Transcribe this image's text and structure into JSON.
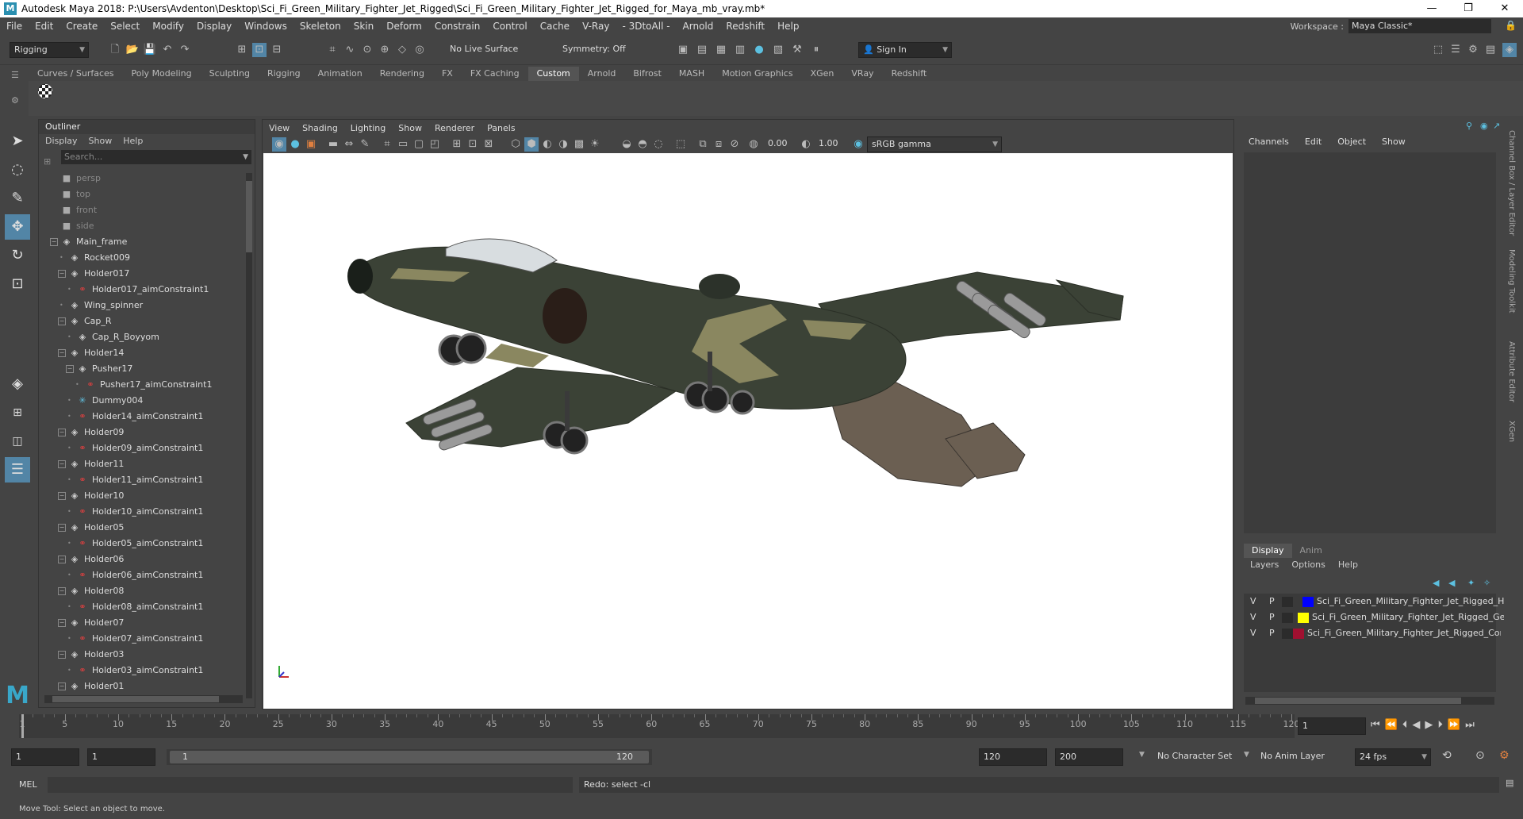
{
  "window": {
    "title": "Autodesk Maya 2018: P:\\Users\\Avdenton\\Desktop\\Sci_Fi_Green_Military_Fighter_Jet_Rigged\\Sci_Fi_Green_Military_Fighter_Jet_Rigged_for_Maya_mb_vray.mb*",
    "minimize": "—",
    "maximize": "❐",
    "close": "✕"
  },
  "menubar": {
    "items": [
      "File",
      "Edit",
      "Create",
      "Select",
      "Modify",
      "Display",
      "Windows",
      "Skeleton",
      "Skin",
      "Deform",
      "Constrain",
      "Control",
      "Cache",
      "V-Ray",
      "- 3DtoAll -",
      "Arnold",
      "Redshift",
      "Help"
    ],
    "workspace_label": "Workspace :",
    "workspace_value": "Maya Classic*"
  },
  "statusline": {
    "mode": "Rigging",
    "live_surface": "No Live Surface",
    "symmetry": "Symmetry: Off",
    "sign_in": "Sign In"
  },
  "shelf": {
    "tabs": [
      "Curves / Surfaces",
      "Poly Modeling",
      "Sculpting",
      "Rigging",
      "Animation",
      "Rendering",
      "FX",
      "FX Caching",
      "Custom",
      "Arnold",
      "Bifrost",
      "MASH",
      "Motion Graphics",
      "XGen",
      "VRay",
      "Redshift"
    ],
    "active_tab": "Custom"
  },
  "outliner": {
    "title": "Outliner",
    "menu": [
      "Display",
      "Show",
      "Help"
    ],
    "search_placeholder": "Search...",
    "rows": [
      {
        "label": "persp",
        "type": "cam",
        "depth": 0,
        "dim": true
      },
      {
        "label": "top",
        "type": "cam",
        "depth": 0,
        "dim": true
      },
      {
        "label": "front",
        "type": "cam",
        "depth": 0,
        "dim": true
      },
      {
        "label": "side",
        "type": "cam",
        "depth": 0,
        "dim": true
      },
      {
        "label": "Main_frame",
        "type": "tr",
        "depth": 0,
        "exp": "-"
      },
      {
        "label": "Rocket009",
        "type": "tr",
        "depth": 1
      },
      {
        "label": "Holder017",
        "type": "tr",
        "depth": 1,
        "exp": "-"
      },
      {
        "label": "Holder017_aimConstraint1",
        "type": "con",
        "depth": 2
      },
      {
        "label": "Wing_spinner",
        "type": "tr",
        "depth": 1
      },
      {
        "label": "Cap_R",
        "type": "tr",
        "depth": 1,
        "exp": "-"
      },
      {
        "label": "Cap_R_Boyyom",
        "type": "tr",
        "depth": 2
      },
      {
        "label": "Holder14",
        "type": "tr",
        "depth": 1,
        "exp": "-"
      },
      {
        "label": "Pusher17",
        "type": "tr",
        "depth": 2,
        "exp": "-"
      },
      {
        "label": "Pusher17_aimConstraint1",
        "type": "con",
        "depth": 3
      },
      {
        "label": "Dummy004",
        "type": "dum",
        "depth": 2
      },
      {
        "label": "Holder14_aimConstraint1",
        "type": "con",
        "depth": 2
      },
      {
        "label": "Holder09",
        "type": "tr",
        "depth": 1,
        "exp": "-"
      },
      {
        "label": "Holder09_aimConstraint1",
        "type": "con",
        "depth": 2
      },
      {
        "label": "Holder11",
        "type": "tr",
        "depth": 1,
        "exp": "-"
      },
      {
        "label": "Holder11_aimConstraint1",
        "type": "con",
        "depth": 2
      },
      {
        "label": "Holder10",
        "type": "tr",
        "depth": 1,
        "exp": "-"
      },
      {
        "label": "Holder10_aimConstraint1",
        "type": "con",
        "depth": 2
      },
      {
        "label": "Holder05",
        "type": "tr",
        "depth": 1,
        "exp": "-"
      },
      {
        "label": "Holder05_aimConstraint1",
        "type": "con",
        "depth": 2
      },
      {
        "label": "Holder06",
        "type": "tr",
        "depth": 1,
        "exp": "-"
      },
      {
        "label": "Holder06_aimConstraint1",
        "type": "con",
        "depth": 2
      },
      {
        "label": "Holder08",
        "type": "tr",
        "depth": 1,
        "exp": "-"
      },
      {
        "label": "Holder08_aimConstraint1",
        "type": "con",
        "depth": 2
      },
      {
        "label": "Holder07",
        "type": "tr",
        "depth": 1,
        "exp": "-"
      },
      {
        "label": "Holder07_aimConstraint1",
        "type": "con",
        "depth": 2
      },
      {
        "label": "Holder03",
        "type": "tr",
        "depth": 1,
        "exp": "-"
      },
      {
        "label": "Holder03_aimConstraint1",
        "type": "con",
        "depth": 2
      },
      {
        "label": "Holder01",
        "type": "tr",
        "depth": 1,
        "exp": "-"
      }
    ]
  },
  "viewport": {
    "menu": [
      "View",
      "Shading",
      "Lighting",
      "Show",
      "Renderer",
      "Panels"
    ],
    "exposure": "0.00",
    "gamma": "1.00",
    "color_space": "sRGB gamma",
    "colors": {
      "body": "#3b4236",
      "camo": "#8a8760",
      "metal": "#7a6a5a"
    }
  },
  "channelbox": {
    "menu": [
      "Channels",
      "Edit",
      "Object",
      "Show"
    ]
  },
  "layer_editor": {
    "tabs": [
      "Display",
      "Anim"
    ],
    "active_tab": "Display",
    "menu": [
      "Layers",
      "Options",
      "Help"
    ],
    "layers": [
      {
        "v": "V",
        "p": "P",
        "color": "#0000ff",
        "name": "Sci_Fi_Green_Military_Fighter_Jet_Rigged_Helpers"
      },
      {
        "v": "V",
        "p": "P",
        "color": "#ffff00",
        "name": "Sci_Fi_Green_Military_Fighter_Jet_Rigged_Geometry"
      },
      {
        "v": "V",
        "p": "P",
        "color": "#a01030",
        "name": "Sci_Fi_Green_Military_Fighter_Jet_Rigged_Controllers"
      }
    ]
  },
  "side_tabs": [
    "Channel Box / Layer Editor",
    "Modeling Toolkit",
    "Attribute Editor",
    "XGen"
  ],
  "timeline": {
    "ticks": [
      1,
      5,
      10,
      15,
      20,
      25,
      30,
      35,
      40,
      45,
      50,
      55,
      60,
      65,
      70,
      75,
      80,
      85,
      90,
      95,
      100,
      105,
      110,
      115,
      120
    ],
    "current_frame": "1"
  },
  "range": {
    "start": "1",
    "anim_start": "1",
    "slider_start": "1",
    "slider_end": "120",
    "end": "120",
    "anim_end": "200",
    "character_set": "No Character Set",
    "anim_layer": "No Anim Layer",
    "fps": "24 fps"
  },
  "cmdline": {
    "lang": "MEL",
    "result": "Redo: select -cl"
  },
  "helpline": "Move Tool: Select an object to move."
}
